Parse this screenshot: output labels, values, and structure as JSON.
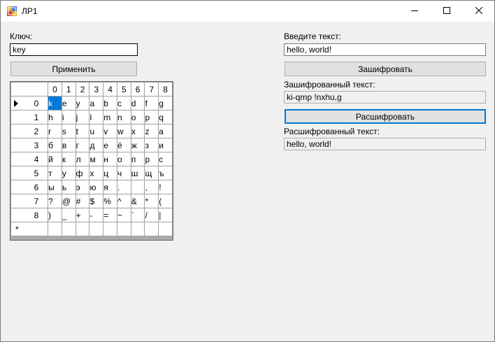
{
  "window": {
    "title": "ЛР1"
  },
  "left": {
    "key_label": "Ключ:",
    "key_value": "key",
    "apply_button": "Применить"
  },
  "grid": {
    "columns": [
      "0",
      "1",
      "2",
      "3",
      "4",
      "5",
      "6",
      "7",
      "8"
    ],
    "rows": [
      {
        "header": "0",
        "cells": [
          "k",
          "e",
          "y",
          "a",
          "b",
          "c",
          "d",
          "f",
          "g"
        ]
      },
      {
        "header": "1",
        "cells": [
          "h",
          "i",
          "j",
          "l",
          "m",
          "n",
          "o",
          "p",
          "q"
        ]
      },
      {
        "header": "2",
        "cells": [
          "r",
          "s",
          "t",
          "u",
          "v",
          "w",
          "x",
          "z",
          "a"
        ]
      },
      {
        "header": "3",
        "cells": [
          "б",
          "в",
          "г",
          "д",
          "е",
          "ё",
          "ж",
          "з",
          "и"
        ]
      },
      {
        "header": "4",
        "cells": [
          "й",
          "к",
          "л",
          "м",
          "н",
          "о",
          "п",
          "р",
          "с"
        ]
      },
      {
        "header": "5",
        "cells": [
          "т",
          "у",
          "ф",
          "х",
          "ц",
          "ч",
          "ш",
          "щ",
          "ъ"
        ]
      },
      {
        "header": "6",
        "cells": [
          "ы",
          "ь",
          "э",
          "ю",
          "я",
          ".",
          " ",
          ",",
          "!"
        ]
      },
      {
        "header": "7",
        "cells": [
          "?",
          "@",
          "#",
          "$",
          "%",
          "^",
          "&",
          "*",
          "("
        ]
      },
      {
        "header": "8",
        "cells": [
          ")",
          "_",
          "+",
          "-",
          "=",
          "~",
          "`",
          "/",
          "|"
        ]
      }
    ],
    "new_row_marker": "*",
    "selected": {
      "row": 0,
      "col": 0
    }
  },
  "right": {
    "input_label": "Введите текст:",
    "input_value": "hello, world!",
    "encrypt_button": "Зашифровать",
    "encrypted_label": "Зашифрованный текст:",
    "encrypted_value": "ki-qmp !nxhu,g",
    "decrypt_button": "Расшифровать",
    "decrypted_label": "Расшифрованный текст:",
    "decrypted_value": "hello, world!"
  },
  "colors": {
    "accent": "#0078d7",
    "titlebar_bg": "#ffffff",
    "window_bg": "#f0f0f0",
    "button_bg": "#e1e1e1"
  },
  "icons": {
    "app": "winforms-app-icon",
    "minimize": "minimize-icon",
    "maximize": "maximize-icon",
    "close": "close-icon",
    "row_pointer": "row-pointer-icon"
  }
}
